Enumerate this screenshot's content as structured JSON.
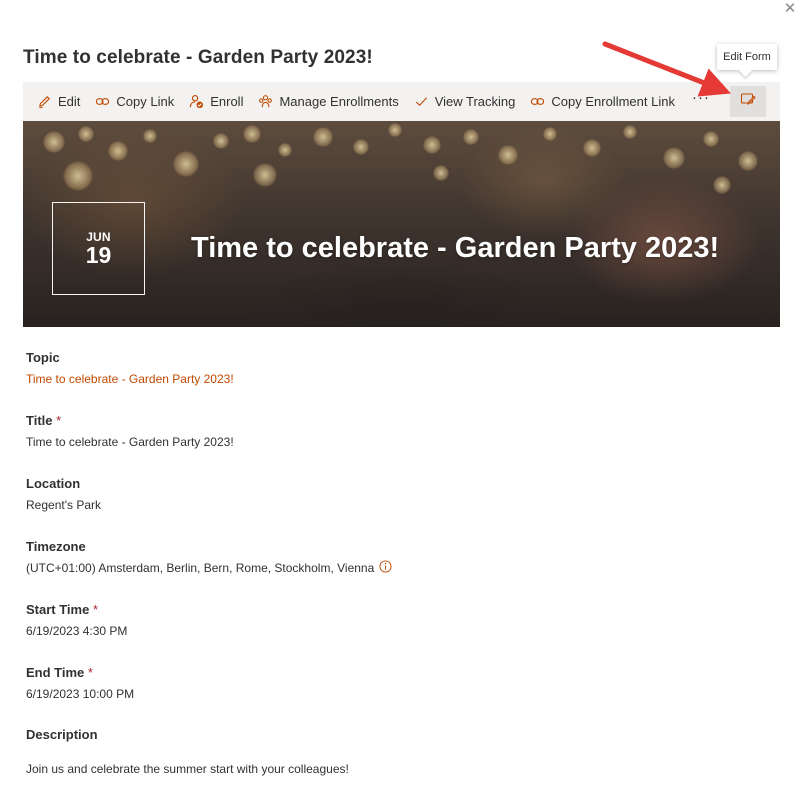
{
  "dialog": {
    "close_icon": "close-icon",
    "title": "Time to celebrate - Garden Party 2023!"
  },
  "toolbar": {
    "items": [
      {
        "label": "Edit",
        "icon": "pencil-icon"
      },
      {
        "label": "Copy Link",
        "icon": "link-icon"
      },
      {
        "label": "Enroll",
        "icon": "enroll-icon"
      },
      {
        "label": "Manage Enrollments",
        "icon": "people-icon"
      },
      {
        "label": "View Tracking",
        "icon": "checkmark-icon"
      },
      {
        "label": "Copy Enrollment Link",
        "icon": "link-icon"
      }
    ],
    "more": "···",
    "edit_form_tooltip": "Edit Form",
    "edit_form_icon": "edit-form-icon"
  },
  "hero": {
    "month": "JUN",
    "day": "19",
    "title": "Time to celebrate - Garden Party 2023!"
  },
  "fields": {
    "topic": {
      "label": "Topic",
      "value": "Time to celebrate - Garden Party 2023!"
    },
    "title": {
      "label": "Title",
      "required": "*",
      "value": "Time to celebrate - Garden Party 2023!"
    },
    "location": {
      "label": "Location",
      "value": "Regent's Park"
    },
    "timezone": {
      "label": "Timezone",
      "value": "(UTC+01:00) Amsterdam, Berlin, Bern, Rome, Stockholm, Vienna"
    },
    "start_time": {
      "label": "Start Time",
      "required": "*",
      "value": "6/19/2023 4:30 PM"
    },
    "end_time": {
      "label": "End Time",
      "required": "*",
      "value": "6/19/2023 10:00 PM"
    },
    "description": {
      "label": "Description",
      "value": "Join us and celebrate the summer start with your colleagues!"
    }
  },
  "colors": {
    "accent_link": "#c14a00",
    "required": "#a4262c",
    "command_bar_bg": "#f3f2f1",
    "annotation_arrow": "#e53935"
  }
}
